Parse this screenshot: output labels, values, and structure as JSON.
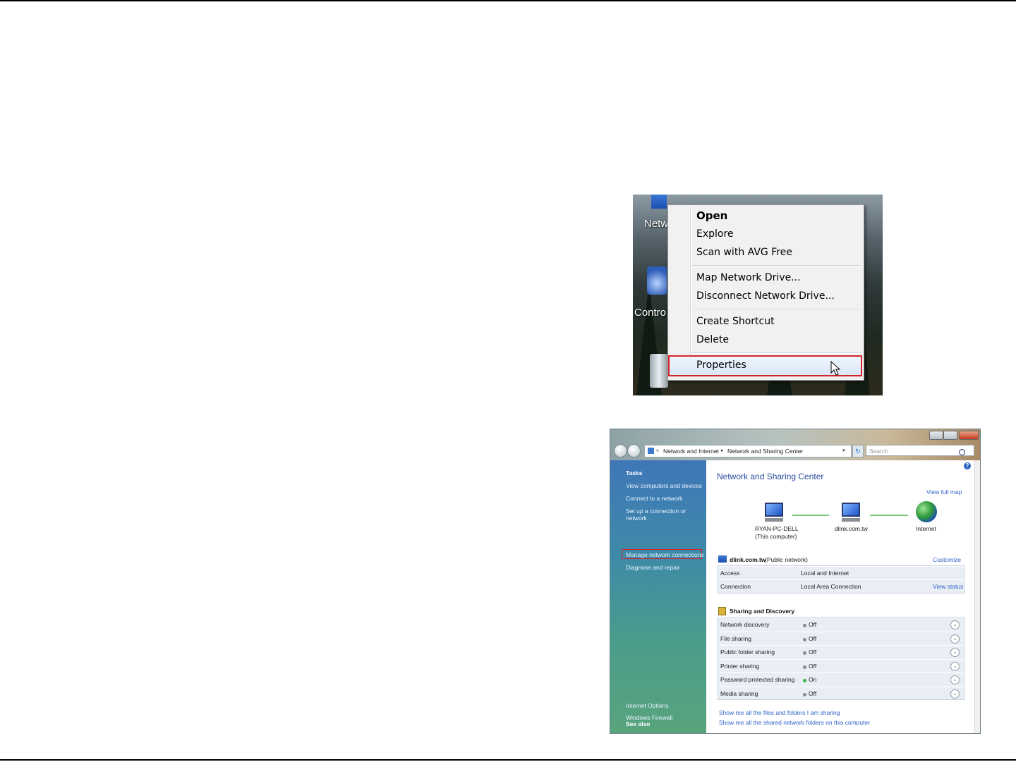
{
  "context_menu": {
    "desktop_labels": [
      "Netw",
      "Contro"
    ],
    "items": [
      {
        "label": "Open",
        "bold": true
      },
      {
        "label": "Explore"
      },
      {
        "label": "Scan with AVG Free"
      },
      {
        "label": "Map Network Drive..."
      },
      {
        "label": "Disconnect Network Drive..."
      },
      {
        "label": "Create Shortcut"
      },
      {
        "label": "Delete"
      },
      {
        "label": "Properties",
        "highlighted": true
      }
    ],
    "highlight_color": "#d9232b"
  },
  "nsc_window": {
    "breadcrumb": [
      "Network and Internet",
      "Network and Sharing Center"
    ],
    "search_placeholder": "Search",
    "sidebar": {
      "tasks_heading": "Tasks",
      "tasks": [
        "View computers and devices",
        "Connect to a network",
        "Set up a connection or network",
        "Manage network connections",
        "Diagnose and repair"
      ],
      "see_also_heading": "See also",
      "see_also": [
        "Internet Options",
        "Windows Firewall"
      ]
    },
    "title": "Network and Sharing Center",
    "view_full_map": "View full map",
    "map": {
      "computer_name": "RYAN-PC-DELL",
      "computer_sub": "(This computer)",
      "network_name": "dlink.com.tw",
      "internet": "Internet"
    },
    "network": {
      "name": "dlink.com.tw",
      "type": "(Public network)",
      "customize": "Customize",
      "rows": [
        {
          "label": "Access",
          "value": "Local and Internet",
          "link": ""
        },
        {
          "label": "Connection",
          "value": "Local Area Connection",
          "link": "View status"
        }
      ]
    },
    "sharing": {
      "heading": "Sharing and Discovery",
      "rows": [
        {
          "label": "Network discovery",
          "state": "Off"
        },
        {
          "label": "File sharing",
          "state": "Off"
        },
        {
          "label": "Public folder sharing",
          "state": "Off"
        },
        {
          "label": "Printer sharing",
          "state": "Off"
        },
        {
          "label": "Password protected sharing",
          "state": "On"
        },
        {
          "label": "Media sharing",
          "state": "Off"
        }
      ]
    },
    "footer_links": [
      "Show me all the files and folders I am sharing",
      "Show me all the shared network folders on this computer"
    ]
  }
}
